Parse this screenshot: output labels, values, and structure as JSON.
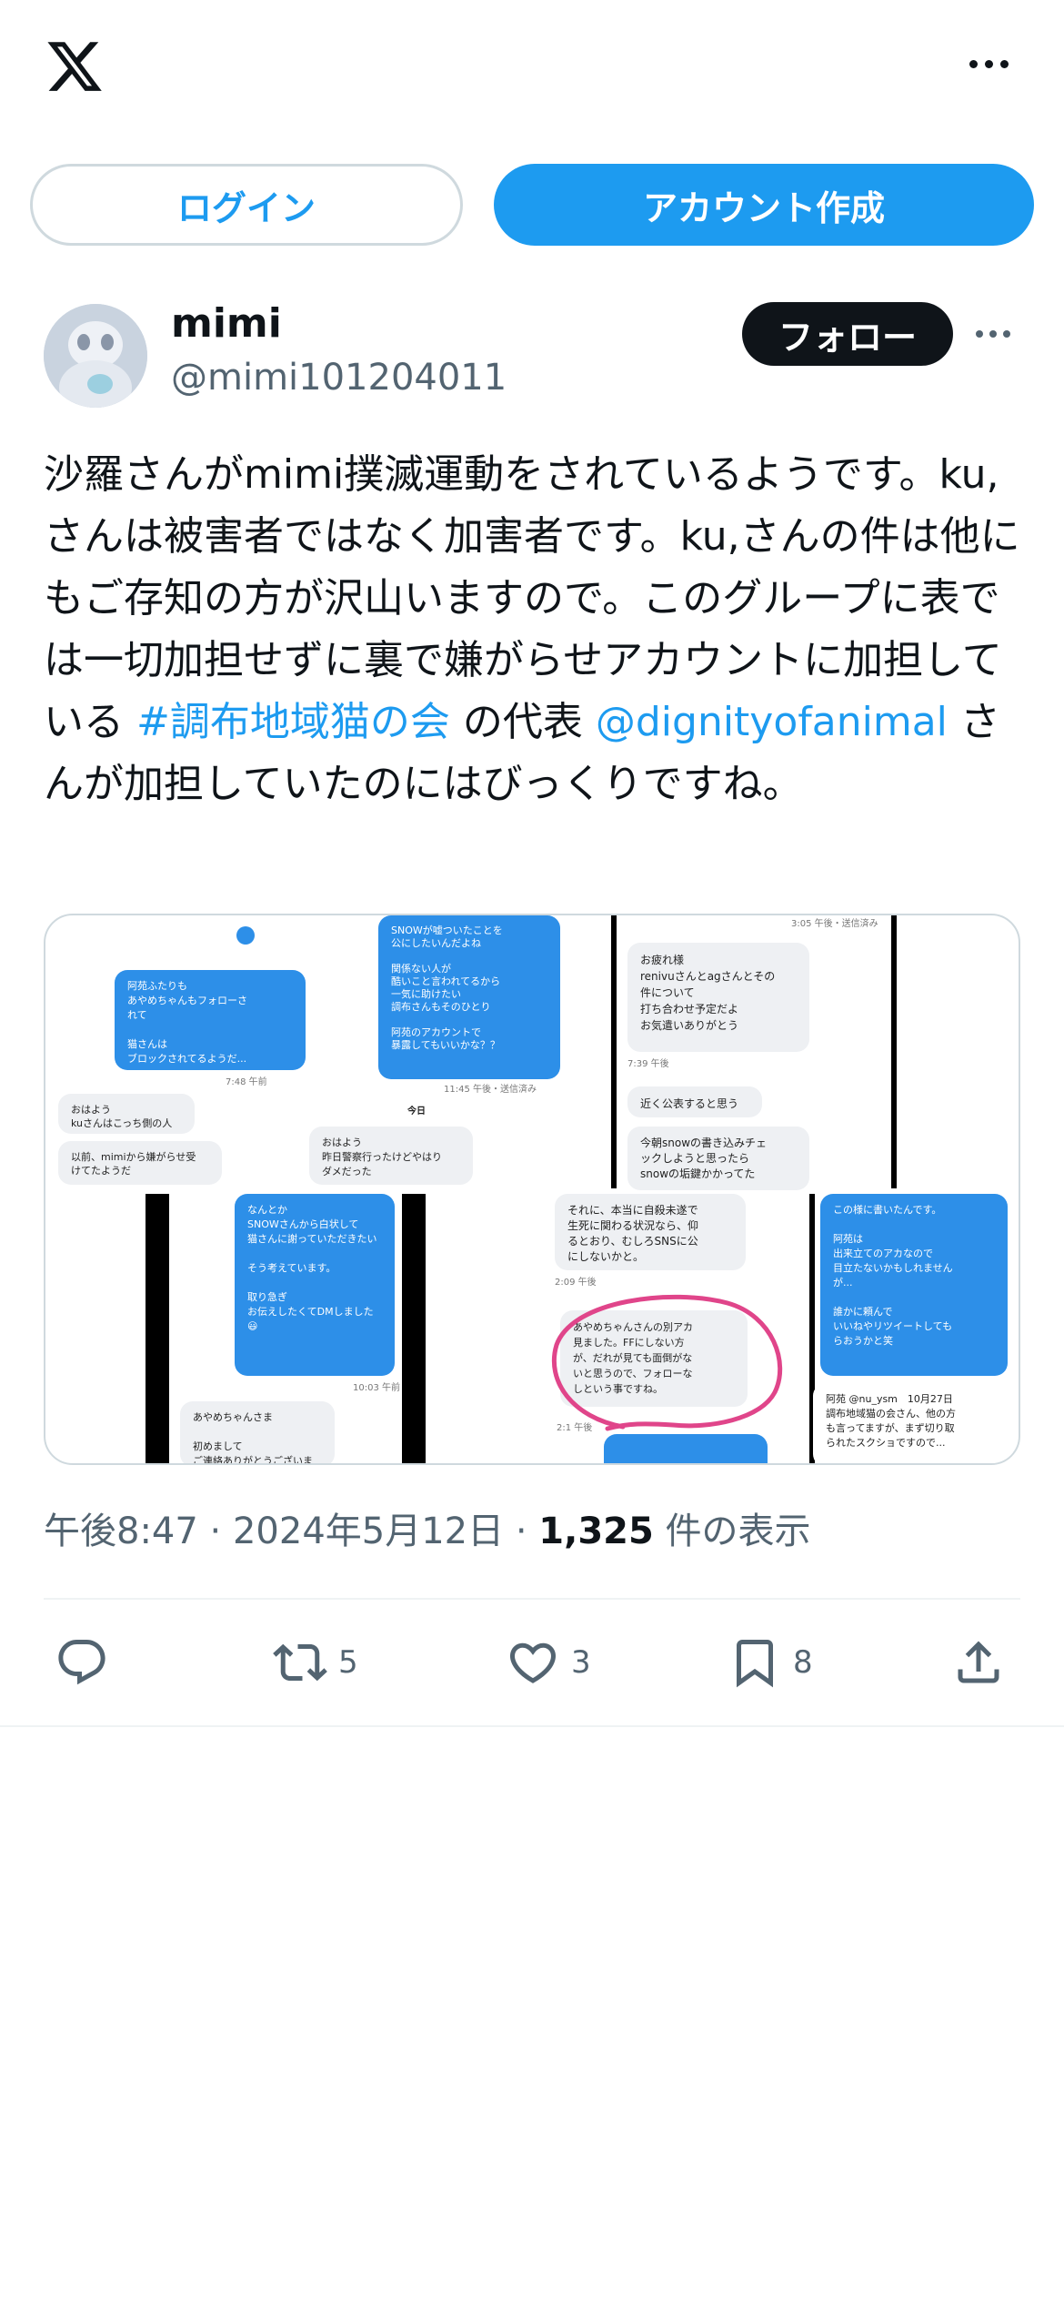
{
  "header": {
    "logo": "x-logo",
    "more_icon": "more-horizontal-icon"
  },
  "auth": {
    "login_label": "ログイン",
    "signup_label": "アカウント作成"
  },
  "author": {
    "name": "mimi",
    "handle": "@mimi101204011",
    "follow_label": "フォロー"
  },
  "post": {
    "text_1": "沙羅さんがmimi撲滅運動をされているようです。ku,さんは被害者ではなく加害者です。ku,さんの件は他にもご存知の方が沢山いますので。このグループに表では一切加担せずに裏で嫌がらせアカウントに加担している ",
    "hashtag": "#調布地域猫の会",
    "text_2": " の代表 ",
    "mention": "@dignityofanimal",
    "text_3": " さんが加担していたのにはびっくりですね。"
  },
  "media": {
    "bubbles": [
      {
        "text": "阿苑ふたりも\nあやめちゃんもフォローさ\nれて\n\n猫さんは\nブロックされてるようだ...",
        "color": "blue"
      },
      {
        "text": "SNOWが嘘ついたことを\n公にしたいんだよね\n\n関係ない人が\n酷いこと言われてるから\n一気に助けたい\n調布さんもそのひとり\n\n阿苑のアカウントで\n暴露してもいいかな？？",
        "color": "blue"
      },
      {
        "text": "お疲れ様\nrenivuさんとagさんとその\n件について\n打ち合わせ予定だよ\nお気遣いありがとう",
        "color": "gray"
      },
      {
        "text": "近く公表すると思う",
        "color": "gray"
      },
      {
        "text": "今朝snowの書き込みチェ\nックしようと思ったら\nsnowの垢鍵かかってた",
        "color": "gray"
      },
      {
        "text": "おはよう\nkuさんはこっち側の人",
        "color": "gray"
      },
      {
        "text": "以前、mimiから嫌がらせ受\nけてたようだ",
        "color": "gray"
      },
      {
        "text": "おはよう\n昨日警察行ったけどやはり\nダメだった",
        "color": "gray"
      },
      {
        "text": "なんとか\nSNOWさんから白状して\n猫さんに謝っていただきたい\n\nそう考えています。\n\n取り急ぎ\nお伝えしたくてDMしました😃",
        "color": "blue"
      },
      {
        "text": "あやめちゃんさま\n\n初めまして\nご連絡ありがとうございま",
        "color": "gray"
      },
      {
        "text": "それに、本当に自殺未遂で\n生死に関わる状況なら、仰\nるとおり、むしろSNSに公\nにしないかと。",
        "color": "gray"
      },
      {
        "text": "あやめちゃんさんの別アカ\n見ました。FFにしない方\nが、だれが見ても面倒がな\nいと思うので、フォローな\nしという事ですね。",
        "color": "gray"
      },
      {
        "text": "この様に書いたんです。\n\n阿苑は\n出来立てのアカなので\n目立たないかもしれません\nが...\n\n誰かに頼んで\nいいねやリツイートしても\nらおうかと笑",
        "color": "blue"
      },
      {
        "text": "阿苑 @nu_ysm　10月27日\n調布地域猫の会さん、他の方\nも言ってますが、まず切り取\nられたスクショですので...",
        "color": "white"
      }
    ],
    "times": [
      "7:48 午前",
      "11:45 午後・送信済み",
      "3:05 午後・送信済み",
      "7:39 午後",
      "今日",
      "10:03 午前",
      "2:09 午後",
      "2:1 午後"
    ]
  },
  "meta": {
    "time": "午後8:47",
    "sep1": " · ",
    "date": "2024年5月12日",
    "sep2": " · ",
    "views_count": "1,325",
    "views_label": " 件の表示"
  },
  "actions": {
    "reply_icon": "reply-icon",
    "retweet_icon": "retweet-icon",
    "retweet_count": "5",
    "like_icon": "heart-icon",
    "like_count": "3",
    "bookmark_icon": "bookmark-icon",
    "bookmark_count": "8",
    "share_icon": "share-icon"
  },
  "colors": {
    "accent": "#1d9bf0",
    "text": "#0f1419",
    "secondary": "#536471",
    "highlight_circle": "#e0458a"
  }
}
